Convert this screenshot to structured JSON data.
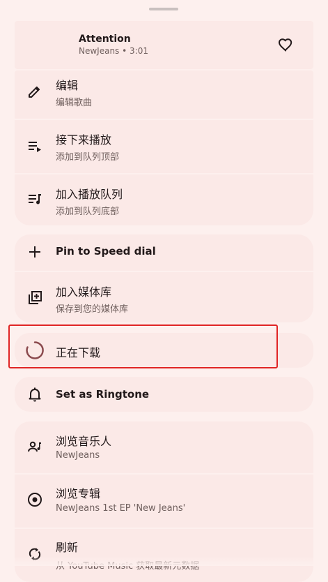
{
  "song": {
    "title": "Attention",
    "subtitle": "NewJeans • 3:01"
  },
  "menu": {
    "edit": {
      "title": "编辑",
      "sub": "编辑歌曲",
      "icon": "pencil-icon"
    },
    "play_next": {
      "title": "接下来播放",
      "sub": "添加到队列顶部",
      "icon": "play-next-icon"
    },
    "add_queue": {
      "title": "加入播放队列",
      "sub": "添加到队列底部",
      "icon": "queue-music-icon"
    },
    "pin": {
      "title": "Pin to Speed dial",
      "icon": "plus-icon"
    },
    "library": {
      "title": "加入媒体库",
      "sub": "保存到您的媒体库",
      "icon": "library-add-icon"
    },
    "download": {
      "title": "正在下载",
      "icon": "loading-spinner-icon"
    },
    "ringtone": {
      "title": "Set as Ringtone",
      "icon": "bell-icon"
    },
    "artist": {
      "title": "浏览音乐人",
      "sub": "NewJeans",
      "icon": "artist-icon"
    },
    "album": {
      "title": "浏览专辑",
      "sub": "NewJeans 1st EP 'New Jeans'",
      "icon": "album-icon"
    },
    "refresh": {
      "title": "刷新",
      "sub": "从 YouTube Music 获取最新元数据",
      "icon": "refresh-icon"
    }
  },
  "colors": {
    "background": "#fdf0ee",
    "card": "#fbe9e7",
    "text": "#22191a",
    "subtext": "#6f5f5d",
    "spinner": "#8b4a4e",
    "highlight": "#e02525"
  }
}
